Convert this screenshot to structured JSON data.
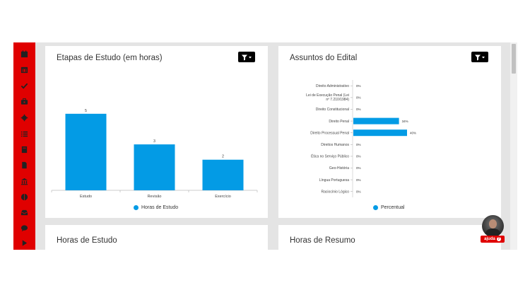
{
  "sidebar": {
    "icons": [
      "calendar-icon",
      "calendar-grid-icon",
      "check-icon",
      "toolbox-icon",
      "gear-icon",
      "list-icon",
      "book-icon",
      "document-icon",
      "bank-icon",
      "pie-icon",
      "inbox-icon",
      "chat-icon",
      "play-icon"
    ]
  },
  "cards": {
    "etapas": {
      "title": "Etapas de Estudo (em horas)",
      "legend": "Horas de Estudo"
    },
    "assuntos": {
      "title": "Assuntos do Edital",
      "legend": "Percentual"
    },
    "horas_estudo": {
      "title": "Horas de Estudo"
    },
    "horas_resumo": {
      "title": "Horas de Resumo"
    }
  },
  "help": {
    "label": "ajuda",
    "icon": "?"
  },
  "colors": {
    "sidebar": "#e00000",
    "bar": "#039be5",
    "background": "#e4e4e4"
  },
  "chart_data": [
    {
      "type": "bar",
      "title": "Etapas de Estudo (em horas)",
      "categories": [
        "Estudo",
        "Revisão",
        "Exercício"
      ],
      "series": [
        {
          "name": "Horas de Estudo",
          "values": [
            5,
            3,
            2
          ]
        }
      ],
      "data_labels": [
        "5",
        "3",
        "2"
      ],
      "ylim": [
        0,
        5.5
      ],
      "grid": false,
      "legend": "bottom"
    },
    {
      "type": "bar",
      "orientation": "horizontal",
      "title": "Assuntos do Edital",
      "categories": [
        "Direito Administrativo",
        "Lei de Execução Penal (Lei nº 7.210/1984)",
        "Direito Constitucional",
        "Direito Penal",
        "Direito Processual Penal",
        "Direitos Humanos",
        "Ética no Serviço Público",
        "Geo-História",
        "Língua Portuguesa",
        "Raciocínio Lógico"
      ],
      "series": [
        {
          "name": "Percentual",
          "values": [
            0,
            0,
            0,
            34,
            40,
            0,
            0,
            0,
            0,
            0
          ]
        }
      ],
      "data_labels": [
        "0%",
        "0%",
        "0%",
        "34%",
        "40%",
        "0%",
        "0%",
        "0%",
        "0%",
        "0%"
      ],
      "xlim": [
        0,
        80
      ],
      "grid": false,
      "legend": "bottom"
    }
  ]
}
